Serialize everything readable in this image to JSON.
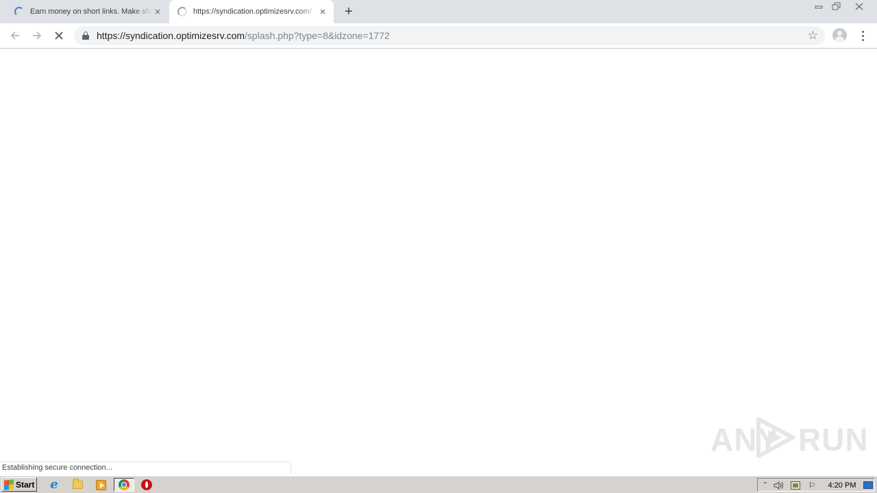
{
  "browser": {
    "tabs": [
      {
        "title": "Earn money on short links. Make sho",
        "state": "loading"
      },
      {
        "title": "https://syndication.optimizesrv.com/",
        "state": "loading"
      }
    ],
    "tab_close_glyph": "×",
    "new_tab_glyph": "+",
    "window_controls": {
      "minimize": "▭",
      "maximize": "⧉",
      "close": "✕"
    },
    "nav": {
      "back": "←",
      "forward": "→",
      "stop": "✕"
    },
    "omnibox": {
      "host": "https://syndication.optimizesrv.com",
      "path": "/splash.php?type=8&idzone=1772"
    },
    "bookmark_star": "☆",
    "status_text": "Establishing secure connection..."
  },
  "watermark": {
    "left": "ANY",
    "right": "RUN"
  },
  "taskbar": {
    "start_label": "Start",
    "pinned": [
      {
        "name": "internet-explorer-icon",
        "glyph": "e"
      },
      {
        "name": "windows-explorer-icon"
      },
      {
        "name": "media-player-icon"
      },
      {
        "name": "chrome-icon",
        "active": true
      },
      {
        "name": "opera-icon"
      }
    ],
    "tray": {
      "expand_glyph": "⌃",
      "volume_glyph": "🔈",
      "flag_glyph": "⚐",
      "clock": "4:20 PM"
    }
  },
  "colors": {
    "tabstrip": "#dee1e6",
    "omnibox_bg": "#f1f3f4",
    "url_host": "#202124",
    "url_path": "#80868b",
    "taskbar": "#d6d3ce"
  }
}
